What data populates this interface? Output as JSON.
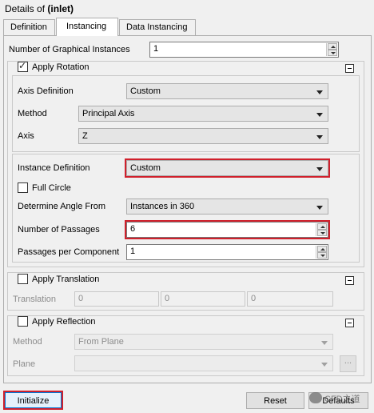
{
  "header": {
    "prefix": "Details of ",
    "name": "(inlet)"
  },
  "tabs": [
    {
      "label": "Definition"
    },
    {
      "label": "Instancing"
    },
    {
      "label": "Data Instancing"
    }
  ],
  "graphical_instances": {
    "label": "Number of Graphical Instances",
    "value": "1"
  },
  "rotation": {
    "label": "Apply Rotation",
    "checked": true,
    "axis_definition": {
      "label": "Axis Definition",
      "value": "Custom"
    },
    "method": {
      "label": "Method",
      "value": "Principal Axis"
    },
    "axis": {
      "label": "Axis",
      "value": "Z"
    },
    "instance_definition": {
      "label": "Instance Definition",
      "value": "Custom"
    },
    "full_circle": {
      "label": "Full Circle",
      "checked": false
    },
    "determine_angle": {
      "label": "Determine Angle From",
      "value": "Instances in 360"
    },
    "passages": {
      "label": "Number of Passages",
      "value": "6"
    },
    "passages_per_component": {
      "label": "Passages per Component",
      "value": "1"
    }
  },
  "translation": {
    "label": "Apply Translation",
    "checked": false,
    "field_label": "Translation",
    "values": [
      "0",
      "0",
      "0"
    ]
  },
  "reflection": {
    "label": "Apply Reflection",
    "checked": false,
    "method": {
      "label": "Method",
      "value": "From Plane"
    },
    "plane": {
      "label": "Plane",
      "value": ""
    },
    "browse_label": "..."
  },
  "footer": {
    "initialize": "Initialize",
    "reset": "Reset",
    "defaults": "Defaults"
  },
  "watermark": {
    "text": "CFD之道"
  },
  "colors": {
    "highlight": "#d0202c",
    "focus": "#0078d7"
  }
}
